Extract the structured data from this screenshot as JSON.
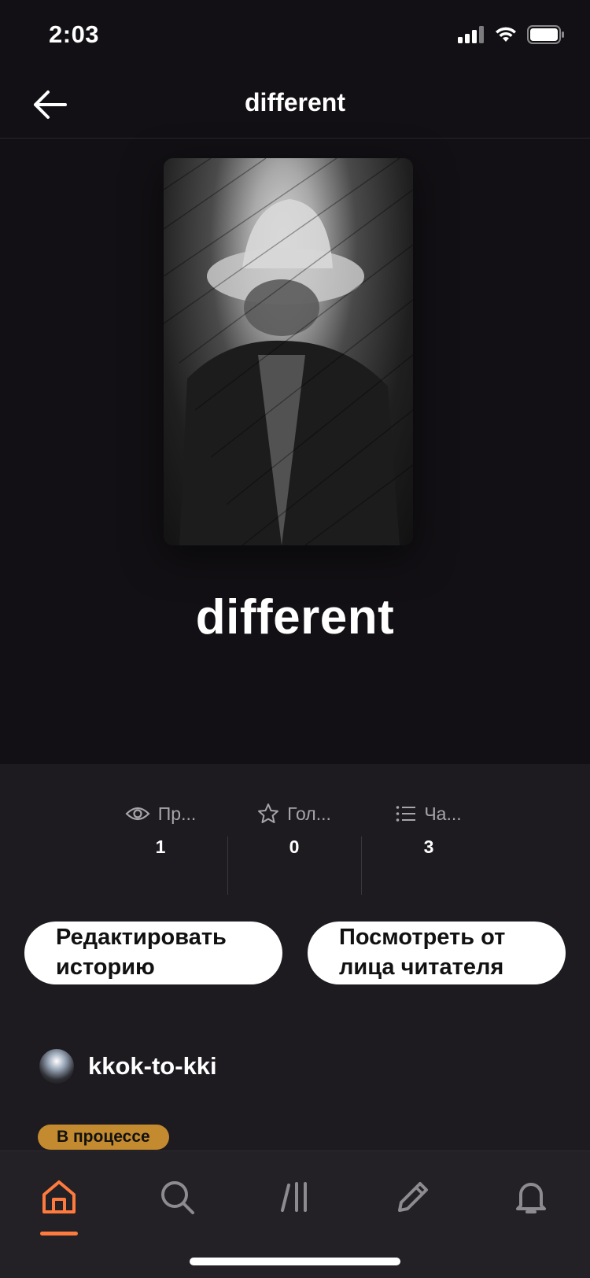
{
  "status_bar": {
    "time": "2:03"
  },
  "nav": {
    "title": "different",
    "back_icon": "arrow-left-icon"
  },
  "story": {
    "title": "different"
  },
  "stats": [
    {
      "icon": "eye-icon",
      "label": "Пр...",
      "value": "1"
    },
    {
      "icon": "star-icon",
      "label": "Гол...",
      "value": "0"
    },
    {
      "icon": "list-icon",
      "label": "Ча...",
      "value": "3"
    }
  ],
  "actions": {
    "edit_label": "Редактировать\nисторию",
    "preview_label": "Посмотреть от\nлица читателя"
  },
  "author": {
    "name": "kkok-to-kki"
  },
  "status_badge": {
    "label": "В процессе",
    "color": "#c38a2f"
  },
  "tabbar": {
    "items": [
      {
        "icon": "home-icon",
        "active": true
      },
      {
        "icon": "search-icon",
        "active": false
      },
      {
        "icon": "library-icon",
        "active": false
      },
      {
        "icon": "pencil-icon",
        "active": false
      },
      {
        "icon": "bell-icon",
        "active": false
      }
    ],
    "accent": "#ff7a3d"
  }
}
